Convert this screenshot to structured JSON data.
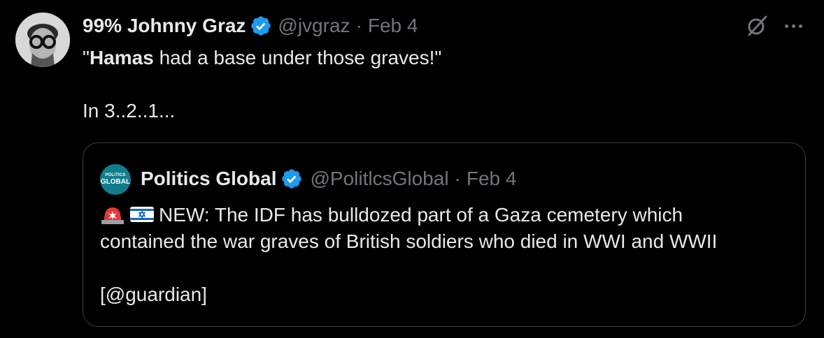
{
  "tweet": {
    "author_name": "99% Johnny Graz",
    "handle": "@jvgraz",
    "separator": "·",
    "date": "Feb 4",
    "text_bold": "Hamas",
    "text_open_quote": "\"",
    "text_line1_rest": " had a base under those graves!\"",
    "text_line2": "In 3..2..1...",
    "icons": {
      "verified": "verified-badge-icon",
      "grok": "grok-icon",
      "more": "more-options-icon"
    }
  },
  "quote": {
    "avatar_top": "POLITICS",
    "avatar_bottom": "GLOBAL",
    "author_name": "Politics Global",
    "handle": "@PolitlcsGlobal",
    "separator": "·",
    "date": "Feb 4",
    "emojis": [
      "police-light-emoji",
      "israel-flag-emoji"
    ],
    "text_line1": "NEW: The IDF has bulldozed part of a Gaza cemetery which",
    "text_line2": "contained the war graves of British soldiers who died in WWI and WWII",
    "text_line3": "[@guardian]"
  },
  "colors": {
    "background": "#000000",
    "text": "#e7e9ea",
    "muted": "#71767b",
    "verified": "#1d9bf0",
    "card_border": "#3b3f44"
  }
}
